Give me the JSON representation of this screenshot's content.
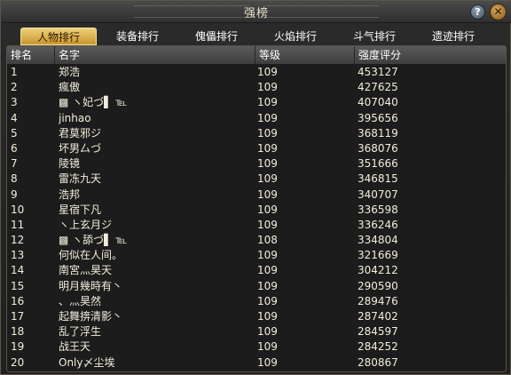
{
  "window": {
    "title": "强榜",
    "help_label": "?",
    "close_label": "✕"
  },
  "tabs": [
    {
      "label": "人物排行",
      "active": true
    },
    {
      "label": "装备排行",
      "active": false
    },
    {
      "label": "傀儡排行",
      "active": false
    },
    {
      "label": "火焰排行",
      "active": false
    },
    {
      "label": "斗气排行",
      "active": false
    },
    {
      "label": "遗迹排行",
      "active": false
    }
  ],
  "table": {
    "headers": {
      "rank": "排名",
      "name": "名字",
      "level": "等级",
      "score": "强度评分"
    },
    "rows": [
      {
        "rank": "1",
        "name": "郑浩",
        "level": "109",
        "score": "453127"
      },
      {
        "rank": "2",
        "name": "瘋傲",
        "level": "109",
        "score": "427625"
      },
      {
        "rank": "3",
        "name": "▩ ヽ妃づ▌ ℡",
        "level": "109",
        "score": "407040"
      },
      {
        "rank": "4",
        "name": "jinhao",
        "level": "109",
        "score": "395656"
      },
      {
        "rank": "5",
        "name": "君莫邪ジ",
        "level": "109",
        "score": "368119"
      },
      {
        "rank": "6",
        "name": "坏男厶づ",
        "level": "109",
        "score": "368076"
      },
      {
        "rank": "7",
        "name": "陵镜",
        "level": "109",
        "score": "351666"
      },
      {
        "rank": "8",
        "name": "雷冻九天",
        "level": "109",
        "score": "346815"
      },
      {
        "rank": "9",
        "name": "浩邦",
        "level": "109",
        "score": "340707"
      },
      {
        "rank": "10",
        "name": "星宿下凡",
        "level": "109",
        "score": "336598"
      },
      {
        "rank": "11",
        "name": "ヽ上玄月ジ",
        "level": "109",
        "score": "336246"
      },
      {
        "rank": "12",
        "name": "▩ ヽ舔づ▌ ℡",
        "level": "108",
        "score": "334804"
      },
      {
        "rank": "13",
        "name": "何似在人间。",
        "level": "109",
        "score": "321669"
      },
      {
        "rank": "14",
        "name": "南宮灬昊天",
        "level": "109",
        "score": "304212"
      },
      {
        "rank": "15",
        "name": "明月幾時有丶",
        "level": "109",
        "score": "290590"
      },
      {
        "rank": "16",
        "name": "、灬昊然",
        "level": "109",
        "score": "289476"
      },
      {
        "rank": "17",
        "name": "起舞捹清影丶",
        "level": "109",
        "score": "287402"
      },
      {
        "rank": "18",
        "name": "乱了浮生",
        "level": "109",
        "score": "284597"
      },
      {
        "rank": "19",
        "name": "战王天",
        "level": "109",
        "score": "284252"
      },
      {
        "rank": "20",
        "name": "Only〆尘埃",
        "level": "109",
        "score": "280867"
      }
    ]
  }
}
